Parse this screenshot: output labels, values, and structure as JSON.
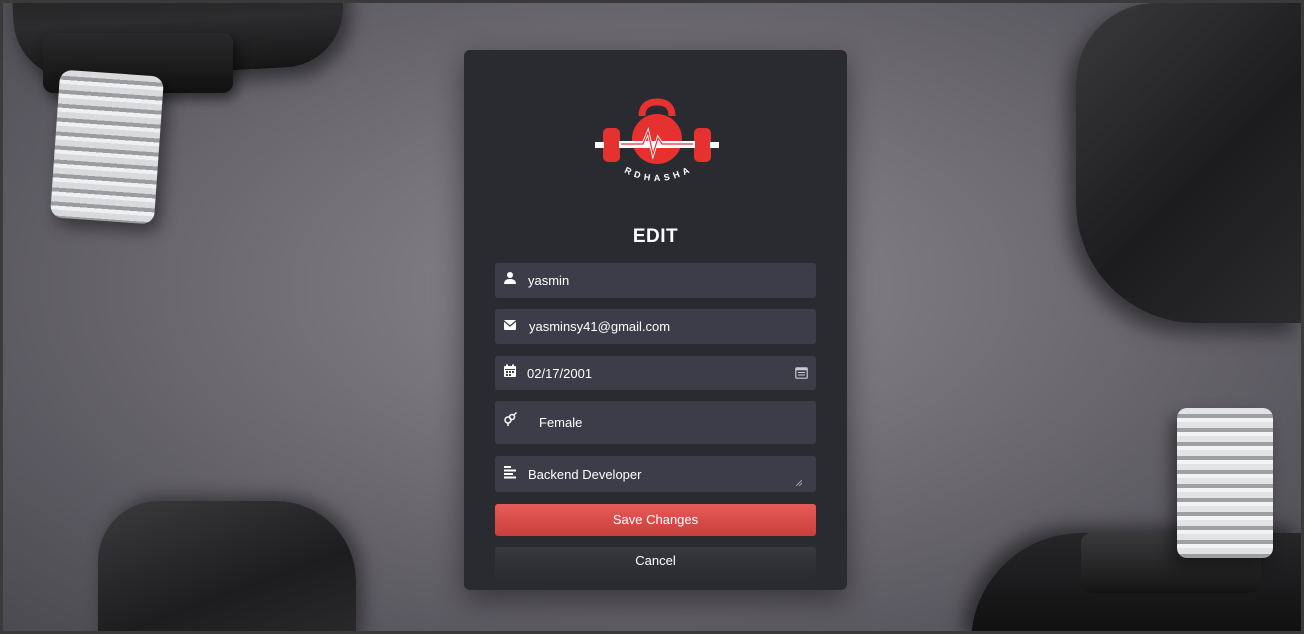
{
  "brand": {
    "logo_text": "RDHASHA",
    "accent_color": "#e5312f"
  },
  "form": {
    "title": "EDIT",
    "fields": {
      "name": {
        "value": "yasmin",
        "icon": "user-icon"
      },
      "email": {
        "value": "yasminsy41@gmail.com",
        "icon": "envelope-icon"
      },
      "birthdate": {
        "value": "02/17/2001",
        "icon": "calendar-icon",
        "picker_icon": "calendar-picker-icon"
      },
      "gender": {
        "value": "Female",
        "icon": "gender-icon"
      },
      "job": {
        "value": "Backend Developer",
        "icon": "align-left-icon"
      }
    },
    "save_label": "Save Changes",
    "cancel_label": "Cancel"
  },
  "colors": {
    "card_background": "#2a2b31",
    "field_background": "#3d3d4a",
    "save_button": "#e0524f",
    "text": "#ffffff"
  }
}
